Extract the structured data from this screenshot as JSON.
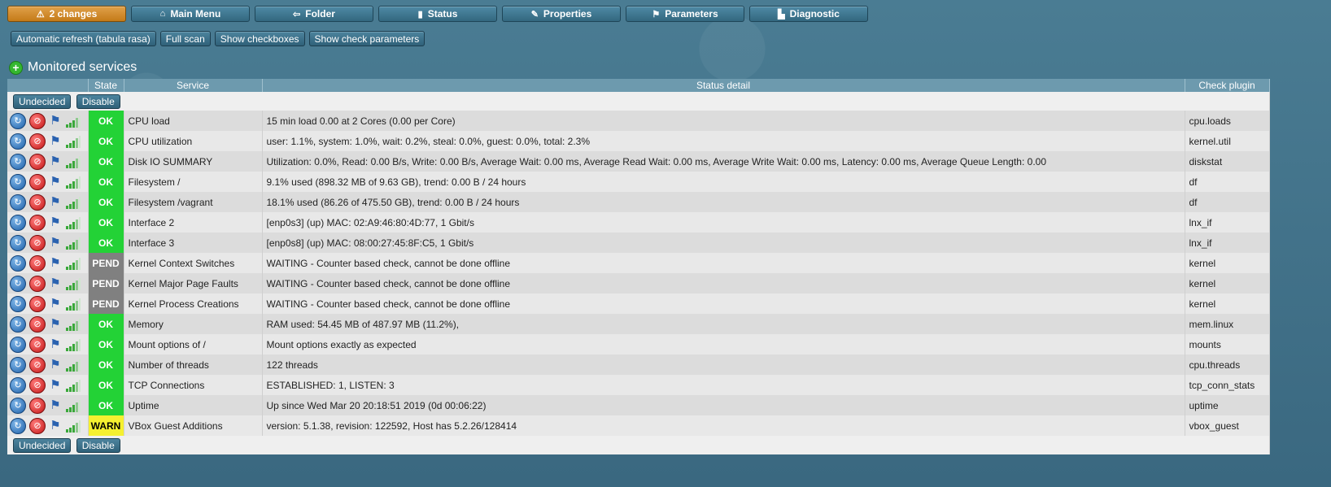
{
  "topmenu": [
    {
      "label": "2 changes",
      "icon": "warning-icon",
      "glyph": "⚠"
    },
    {
      "label": "Main Menu",
      "icon": "home-icon",
      "glyph": "⌂"
    },
    {
      "label": "Folder",
      "icon": "back-arrow-icon",
      "glyph": "⇦"
    },
    {
      "label": "Status",
      "icon": "status-icon",
      "glyph": "▮"
    },
    {
      "label": "Properties",
      "icon": "pencil-icon",
      "glyph": "✎"
    },
    {
      "label": "Parameters",
      "icon": "parameters-icon",
      "glyph": "⚑"
    },
    {
      "label": "Diagnostic",
      "icon": "diagnostic-icon",
      "glyph": "▙"
    }
  ],
  "actions": {
    "refresh": "Automatic refresh (tabula rasa)",
    "fullscan": "Full scan",
    "checkboxes": "Show checkboxes",
    "checkparams": "Show check parameters"
  },
  "section_title": "Monitored services",
  "columns": {
    "state": "State",
    "service": "Service",
    "detail": "Status detail",
    "plugin": "Check plugin"
  },
  "bulk": {
    "undecided": "Undecided",
    "disable": "Disable"
  },
  "state_colors": {
    "OK": "#23d236",
    "PEND": "#808080",
    "WARN": "#f5f030"
  },
  "rows": [
    {
      "state": "OK",
      "service": "CPU load",
      "detail": "15 min load 0.00 at 2 Cores (0.00 per Core)",
      "plugin": "cpu.loads"
    },
    {
      "state": "OK",
      "service": "CPU utilization",
      "detail": "user: 1.1%, system: 1.0%, wait: 0.2%, steal: 0.0%, guest: 0.0%, total: 2.3%",
      "plugin": "kernel.util"
    },
    {
      "state": "OK",
      "service": "Disk IO SUMMARY",
      "detail": "Utilization: 0.0%, Read: 0.00 B/s, Write: 0.00 B/s, Average Wait: 0.00 ms, Average Read Wait: 0.00 ms, Average Write Wait: 0.00 ms, Latency: 0.00 ms, Average Queue Length: 0.00",
      "plugin": "diskstat"
    },
    {
      "state": "OK",
      "service": "Filesystem /",
      "detail": "9.1% used (898.32 MB of 9.63 GB), trend: 0.00 B / 24 hours",
      "plugin": "df"
    },
    {
      "state": "OK",
      "service": "Filesystem /vagrant",
      "detail": "18.1% used (86.26 of 475.50 GB), trend: 0.00 B / 24 hours",
      "plugin": "df"
    },
    {
      "state": "OK",
      "service": "Interface 2",
      "detail": "[enp0s3] (up) MAC: 02:A9:46:80:4D:77, 1 Gbit/s",
      "plugin": "lnx_if"
    },
    {
      "state": "OK",
      "service": "Interface 3",
      "detail": "[enp0s8] (up) MAC: 08:00:27:45:8F:C5, 1 Gbit/s",
      "plugin": "lnx_if"
    },
    {
      "state": "PEND",
      "service": "Kernel Context Switches",
      "detail": "WAITING - Counter based check, cannot be done offline",
      "plugin": "kernel"
    },
    {
      "state": "PEND",
      "service": "Kernel Major Page Faults",
      "detail": "WAITING - Counter based check, cannot be done offline",
      "plugin": "kernel"
    },
    {
      "state": "PEND",
      "service": "Kernel Process Creations",
      "detail": "WAITING - Counter based check, cannot be done offline",
      "plugin": "kernel"
    },
    {
      "state": "OK",
      "service": "Memory",
      "detail": "RAM used: 54.45 MB of 487.97 MB (11.2%),",
      "plugin": "mem.linux"
    },
    {
      "state": "OK",
      "service": "Mount options of /",
      "detail": "Mount options exactly as expected",
      "plugin": "mounts"
    },
    {
      "state": "OK",
      "service": "Number of threads",
      "detail": "122 threads",
      "plugin": "cpu.threads"
    },
    {
      "state": "OK",
      "service": "TCP Connections",
      "detail": "ESTABLISHED: 1, LISTEN: 3",
      "plugin": "tcp_conn_stats"
    },
    {
      "state": "OK",
      "service": "Uptime",
      "detail": "Up since Wed Mar 20 20:18:51 2019 (0d 00:06:22)",
      "plugin": "uptime"
    },
    {
      "state": "WARN",
      "service": "VBox Guest Additions",
      "detail": "version: 5.1.38, revision: 122592, Host has 5.2.26/128414",
      "plugin": "vbox_guest"
    }
  ]
}
